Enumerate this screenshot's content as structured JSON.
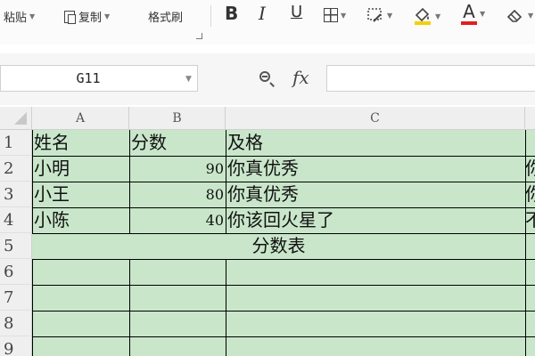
{
  "toolbar": {
    "paste_label": "粘贴",
    "copy_label": "复制",
    "format_painter_label": "格式刷",
    "bold_glyph": "B",
    "italic_glyph": "I",
    "underline_glyph": "U",
    "font_color_glyph": "A",
    "font_color": "#e02020",
    "fill_color": "#f5d000"
  },
  "formula_bar": {
    "cell_ref": "G11",
    "fx_label": "fx",
    "value": ""
  },
  "columns": [
    "A",
    "B",
    "C"
  ],
  "rows": [
    "1",
    "2",
    "3",
    "4",
    "5",
    "6",
    "7",
    "8",
    "9"
  ],
  "cells": {
    "r1": {
      "a": "姓名",
      "b": "分数",
      "c": "及格"
    },
    "r2": {
      "a": "小明",
      "b": "90",
      "c": "你真优秀",
      "d": "你"
    },
    "r3": {
      "a": "小王",
      "b": "80",
      "c": "你真优秀",
      "d": "你"
    },
    "r4": {
      "a": "小陈",
      "b": "40",
      "c": "你该回火星了",
      "d": "不"
    },
    "r5": {
      "merged": "分数表"
    }
  },
  "colors": {
    "cell_fill": "#c9e6ca",
    "header_bg": "#efefef"
  }
}
